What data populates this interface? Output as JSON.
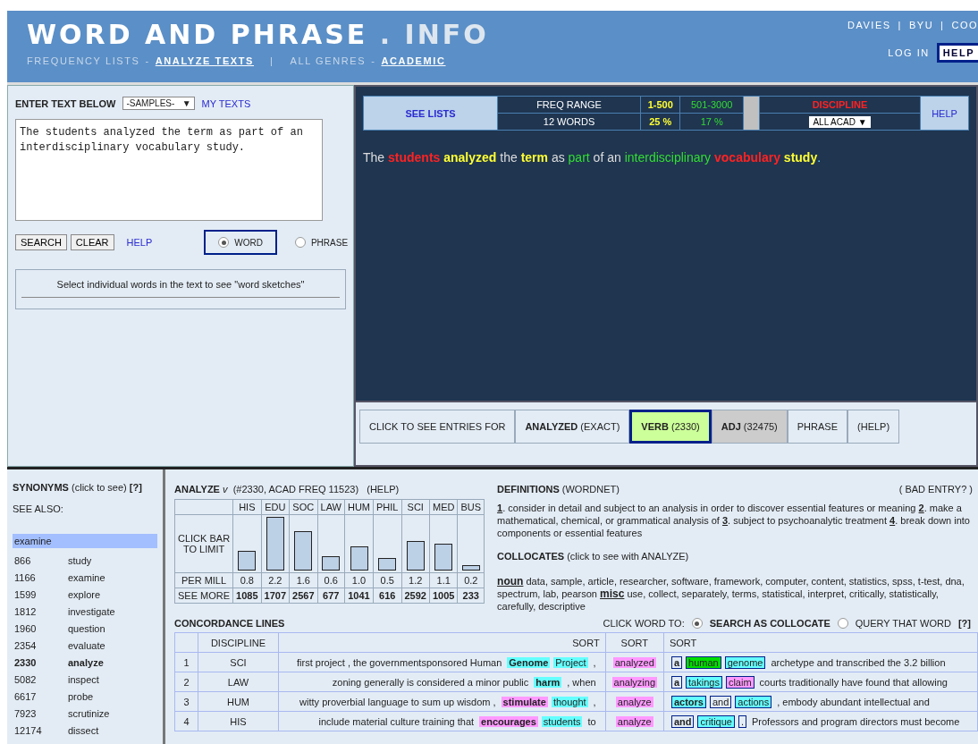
{
  "header": {
    "logo_main": "WORD AND PHRASE",
    "logo_dot": ".",
    "logo_suffix": "INFO",
    "nav": [
      {
        "label": "FREQUENCY LISTS",
        "selected": false
      },
      {
        "prefix": "-",
        "label": "ANALYZE TEXTS",
        "selected": true
      },
      {
        "prefix": "|",
        "label": "ALL GENRES",
        "selected": false
      },
      {
        "prefix": "-",
        "label": "ACADEMIC",
        "selected": true
      }
    ],
    "top_links": [
      {
        "label": "DAVIES"
      },
      {
        "prefix": "|",
        "label": "BYU"
      },
      {
        "prefix": "|",
        "label": "COO"
      }
    ],
    "login": "LOG IN",
    "help": "HELP"
  },
  "input_panel": {
    "label": "ENTER TEXT BELOW",
    "samples": "-SAMPLES-",
    "arrow": "▼",
    "my_texts": "MY TEXTS",
    "text": "The students analyzed the term as part of an interdisciplinary vocabulary study.",
    "buttons": [
      "SEARCH",
      "CLEAR"
    ],
    "help": "HELP",
    "modes": [
      {
        "label": "WORD",
        "selected": true
      },
      {
        "label": "PHRASE",
        "selected": false
      }
    ],
    "hint": "Select individual words in the text to see \"word sketches\""
  },
  "freq_table": {
    "see_lists": "SEE LISTS",
    "range_label": "FREQ RANGE",
    "words_label": "12 WORDS",
    "bands": [
      {
        "range": "1-500",
        "share": "25 %",
        "color": "#ffff33"
      },
      {
        "range": "501-3000",
        "share": "17 %",
        "color": "#33dd33"
      }
    ],
    "discipline_label": "DISCIPLINE",
    "discipline_value": "ALL ACAD",
    "discipline_arrow": "▼",
    "help": "HELP"
  },
  "sentence": [
    {
      "text": "The",
      "color": "#dddddd",
      "bold": false
    },
    {
      "text": "students",
      "color": "#ff2222",
      "bold": true
    },
    {
      "text": "analyzed",
      "color": "#ffff33",
      "bold": true
    },
    {
      "text": "the",
      "color": "#dddddd",
      "bold": false
    },
    {
      "text": "term",
      "color": "#ffff33",
      "bold": true
    },
    {
      "text": "as",
      "color": "#dddddd",
      "bold": false
    },
    {
      "text": "part",
      "color": "#33dd33",
      "bold": false
    },
    {
      "text": "of",
      "color": "#dddddd",
      "bold": false
    },
    {
      "text": "an",
      "color": "#dddddd",
      "bold": false
    },
    {
      "text": "interdisciplinary",
      "color": "#33dd33",
      "bold": false
    },
    {
      "text": "vocabulary",
      "color": "#ff2222",
      "bold": true
    },
    {
      "text": "study",
      "color": "#ffff33",
      "bold": true
    }
  ],
  "sentence_end": ".",
  "entries": {
    "label": "CLICK TO SEE ENTRIES FOR",
    "items": [
      {
        "bold": "ANALYZED",
        "rest": "(EXACT)",
        "selected": false,
        "greyed": false
      },
      {
        "bold": "VERB",
        "rest": "(2330)",
        "selected": true,
        "greyed": false
      },
      {
        "bold": "ADJ",
        "rest": "(32475)",
        "selected": false,
        "greyed": true
      },
      {
        "rest": "PHRASE",
        "selected": false,
        "greyed": false
      },
      {
        "rest": "(HELP)",
        "selected": false,
        "greyed": false
      }
    ]
  },
  "synonyms": {
    "title": "SYNONYMS",
    "note": "(click to see)",
    "help": "[?]",
    "see_also": "SEE ALSO:",
    "highlighted": "examine",
    "rows": [
      {
        "rank": "866",
        "word": "study",
        "current": false
      },
      {
        "rank": "1166",
        "word": "examine",
        "current": false
      },
      {
        "rank": "1599",
        "word": "explore",
        "current": false
      },
      {
        "rank": "1812",
        "word": "investigate",
        "current": false
      },
      {
        "rank": "1960",
        "word": "question",
        "current": false
      },
      {
        "rank": "2354",
        "word": "evaluate",
        "current": false
      },
      {
        "rank": "2330",
        "word": "analyze",
        "current": true
      },
      {
        "rank": "5082",
        "word": "inspect",
        "current": false
      },
      {
        "rank": "6617",
        "word": "probe",
        "current": false
      },
      {
        "rank": "7923",
        "word": "scrutinize",
        "current": false
      },
      {
        "rank": "12174",
        "word": "dissect",
        "current": false
      }
    ]
  },
  "analyze": {
    "word": "ANALYZE",
    "pos": "v",
    "info": "(#2330, ACAD FREQ 11523)",
    "help": "(HELP)",
    "bar_label": "CLICK BAR TO LIMIT",
    "per_mill_label": "PER MILL",
    "see_more_label": "SEE MORE",
    "columns": [
      {
        "name": "HIS",
        "per_mill": "0.8",
        "see_more": "1085",
        "level": 0.36
      },
      {
        "name": "EDU",
        "per_mill": "2.2",
        "see_more": "1707",
        "level": 1
      },
      {
        "name": "SOC",
        "per_mill": "1.6",
        "see_more": "2567",
        "level": 0.73
      },
      {
        "name": "LAW",
        "per_mill": "0.6",
        "see_more": "677",
        "level": 0.27
      },
      {
        "name": "HUM",
        "per_mill": "1.0",
        "see_more": "1041",
        "level": 0.45
      },
      {
        "name": "PHIL",
        "per_mill": "0.5",
        "see_more": "616",
        "level": 0.23
      },
      {
        "name": "SCI",
        "per_mill": "1.2",
        "see_more": "2592",
        "level": 0.55
      },
      {
        "name": "MED",
        "per_mill": "1.1",
        "see_more": "1005",
        "level": 0.5
      },
      {
        "name": "BUS",
        "per_mill": "0.2",
        "see_more": "233",
        "level": 0.1
      }
    ]
  },
  "definitions": {
    "title": "DEFINITIONS",
    "source": "(WORDNET)",
    "bad_entry": "( BAD ENTRY? )",
    "items": [
      {
        "number": "1",
        "text": ". consider in detail and subject to an analysis in order to discover essential features or meaning"
      },
      {
        "number": "2",
        "text": ". make a mathematical, chemical, or grammatical analysis of"
      },
      {
        "number": "3",
        "text": ". subject to psychoanalytic treatment"
      },
      {
        "number": "4",
        "text": ". break down into components or essential features"
      }
    ]
  },
  "collocates": {
    "title": "COLLOCATES",
    "note": "(click to see with ANALYZE)",
    "groups": [
      {
        "pos": "noun",
        "words": "data, sample, article, researcher, software, framework, computer, content, statistics, spss, t-test, dna, spectrum, lab, pearson"
      },
      {
        "pos": "misc",
        "words": "use, collect, separately, terms, statistical, interpret, critically, statistically, carefully, descriptive"
      }
    ]
  },
  "concordance": {
    "title": "CONCORDANCE LINES",
    "click_label": "CLICK WORD TO:",
    "options": [
      {
        "label": "SEARCH AS COLLOCATE",
        "selected": true
      },
      {
        "label": "QUERY THAT WORD",
        "selected": false
      }
    ],
    "help": "[?]",
    "columns": [
      "DISCIPLINE",
      "SORT",
      "SORT",
      "SORT"
    ],
    "rows": [
      {
        "number": "1",
        "discipline": "SCI",
        "node": "analyzed",
        "left": [
          {
            "text": "first project , the governmentsponsored Human",
            "bold": false
          },
          {
            "text": "Genome",
            "color": "#66ffff",
            "bold": true
          },
          {
            "text": "Project",
            "color": "#66ffff",
            "bold": false
          },
          {
            "text": ",",
            "bold": false
          }
        ],
        "right": [
          {
            "text": "a",
            "bold": true,
            "boxed": true
          },
          {
            "text": "human",
            "color": "#00dd00",
            "bold": false,
            "boxed": true
          },
          {
            "text": "genome",
            "color": "#66ffff",
            "bold": false,
            "boxed": true
          },
          {
            "text": "archetype and transcribed the 3.2 billion",
            "bold": false,
            "boxed": false
          }
        ]
      },
      {
        "number": "2",
        "discipline": "LAW",
        "node": "analyzing",
        "left": [
          {
            "text": "zoning generally is considered a minor public",
            "bold": false
          },
          {
            "text": "harm",
            "color": "#66ffff",
            "bold": true
          },
          {
            "text": ",  when",
            "bold": false
          }
        ],
        "right": [
          {
            "text": "a",
            "bold": true,
            "boxed": true
          },
          {
            "text": "takings",
            "color": "#66ffff",
            "bold": false,
            "boxed": true
          },
          {
            "text": "claim",
            "color": "#ff99ff",
            "bold": false,
            "boxed": true
          },
          {
            "text": "courts traditionally have found that allowing",
            "bold": false,
            "boxed": false
          }
        ]
      },
      {
        "number": "3",
        "discipline": "HUM",
        "node": "analyze",
        "left": [
          {
            "text": "witty proverbial language to sum up wisdom ,",
            "bold": false
          },
          {
            "text": "stimulate",
            "color": "#ff99ff",
            "bold": true
          },
          {
            "text": "thought",
            "color": "#66ffff",
            "bold": false
          },
          {
            "text": ",",
            "bold": false
          }
        ],
        "right": [
          {
            "text": "actors",
            "color": "#66ffff",
            "bold": true,
            "boxed": true
          },
          {
            "text": "and",
            "bold": false,
            "boxed": true
          },
          {
            "text": "actions",
            "color": "#66ffff",
            "bold": false,
            "boxed": true
          },
          {
            "text": ", embody abundant intellectual and",
            "bold": false,
            "boxed": false
          }
        ]
      },
      {
        "number": "4",
        "discipline": "HIS",
        "node": "analyze",
        "left": [
          {
            "text": "include material culture training that",
            "bold": false
          },
          {
            "text": "encourages",
            "color": "#ff99ff",
            "bold": true
          },
          {
            "text": "students",
            "color": "#66ffff",
            "bold": false
          },
          {
            "text": "to",
            "bold": false
          }
        ],
        "right": [
          {
            "text": "and",
            "bold": true,
            "boxed": true
          },
          {
            "text": "critique",
            "color": "#66ffff",
            "bold": false,
            "boxed": true
          },
          {
            "text": ".",
            "bold": false,
            "boxed": true
          },
          {
            "text": "Professors and program directors must become",
            "bold": false,
            "boxed": false
          }
        ]
      }
    ]
  }
}
